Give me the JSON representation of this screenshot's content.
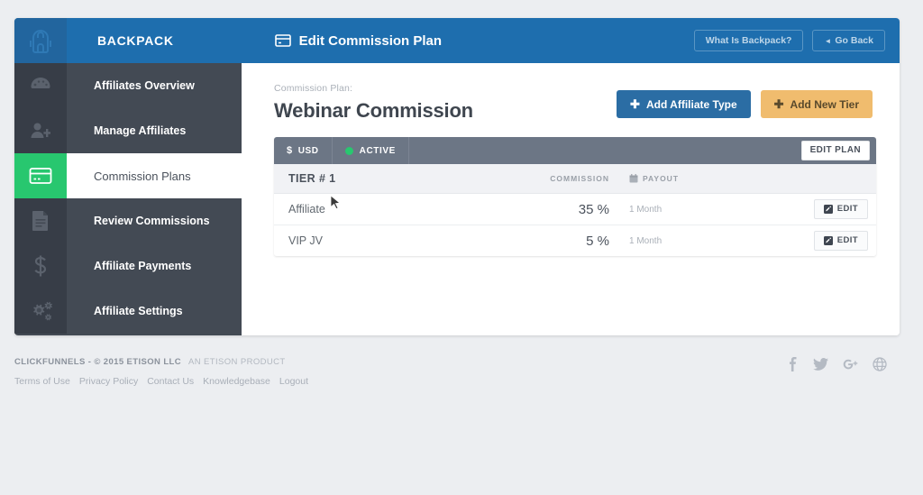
{
  "topbar": {
    "brand": "BACKPACK",
    "logo_icon": "backpack-icon",
    "title": "Edit Commission Plan",
    "title_icon": "credit-card-icon",
    "what_is_backpack_label": "What Is Backpack?",
    "go_back_label": "Go Back",
    "go_back_caret": "◄",
    "bg_color": "#1e6eae"
  },
  "sidebar": {
    "bg_color": "#434a54",
    "active_color": "#28c76f",
    "items": [
      {
        "label": "Affiliates Overview",
        "icon": "dashboard-gauge-icon",
        "active": false
      },
      {
        "label": "Manage Affiliates",
        "icon": "user-add-icon",
        "active": false
      },
      {
        "label": "Commission Plans",
        "icon": "credit-card-icon",
        "active": true
      },
      {
        "label": "Review Commissions",
        "icon": "document-icon",
        "active": false
      },
      {
        "label": "Affiliate Payments",
        "icon": "dollar-sign-icon",
        "active": false
      },
      {
        "label": "Affiliate Settings",
        "icon": "gears-icon",
        "active": false
      }
    ]
  },
  "main": {
    "kicker": "Commission Plan:",
    "plan_title": "Webinar Commission",
    "add_affiliate_type_label": "Add Affiliate Type",
    "add_new_tier_label": "Add New Tier",
    "plus_glyph": "✚",
    "add_affiliate_type_color": "#2b6da4",
    "add_new_tier_color": "#f0bc6e"
  },
  "plan_card": {
    "currency_symbol": "$",
    "currency_label": "USD",
    "status_label": "ACTIVE",
    "status_color": "#28c76f",
    "edit_plan_label": "EDIT PLAN",
    "tier_label": "TIER # 1",
    "columns": {
      "commission": "COMMISSION",
      "payout": "PAYOUT",
      "payout_icon": "calendar-icon"
    },
    "rows": [
      {
        "name": "Affiliate",
        "commission": "35 %",
        "payout": "1 Month",
        "edit_label": "EDIT",
        "edit_icon": "pencil-icon"
      },
      {
        "name": "VIP JV",
        "commission": "5 %",
        "payout": "1 Month",
        "edit_label": "EDIT",
        "edit_icon": "pencil-icon"
      }
    ]
  },
  "footer": {
    "copyright_strong": "CLICKFUNNELS - © 2015 ETISON LLC",
    "copyright_muted": "AN ETISON PRODUCT",
    "links": [
      "Terms of Use",
      "Privacy Policy",
      "Contact Us",
      "Knowledgebase",
      "Logout"
    ],
    "social": [
      "facebook-icon",
      "twitter-icon",
      "google-plus-icon",
      "globe-icon"
    ]
  }
}
